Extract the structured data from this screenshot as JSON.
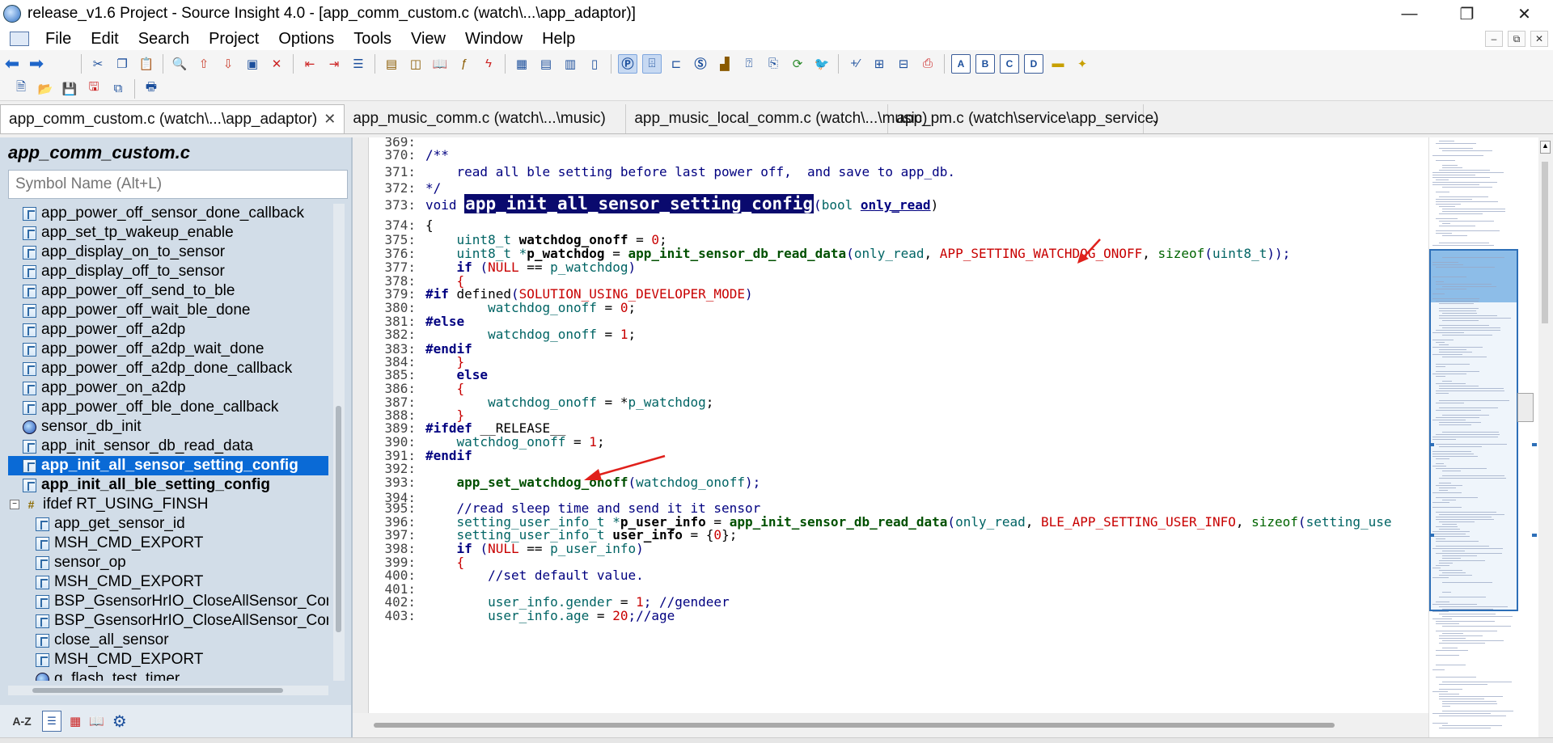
{
  "window": {
    "title": "release_v1.6 Project - Source Insight 4.0 - [app_comm_custom.c (watch\\...\\app_adaptor)]",
    "minimize_glyph": "—",
    "maximize_glyph": "❐",
    "close_glyph": "✕"
  },
  "menu": {
    "items": [
      "File",
      "Edit",
      "Search",
      "Project",
      "Options",
      "Tools",
      "View",
      "Window",
      "Help"
    ],
    "mdi_minimize": "–",
    "mdi_restore": "⧉",
    "mdi_close": "✕"
  },
  "toolbar1": {
    "buttons": [
      "back-icon",
      "forward-icon",
      "cut-icon",
      "copy-icon",
      "paste-icon",
      "find-icon",
      "jump-up-icon",
      "jump-down-icon",
      "browse-icon",
      "replace-icon",
      "bookmark-prev-icon",
      "bookmark-next-icon",
      "bookmark-list-icon",
      "project-icon",
      "symbol-window-icon",
      "book-icon",
      "function-icon",
      "lightning-icon",
      "layout-1-icon",
      "layout-2-icon",
      "layout-3-icon",
      "layout-4-icon",
      "p-icon",
      "relation-window-icon",
      "call-tree-icon",
      "s-icon",
      "blocks-icon",
      "help-icon",
      "clip-icon",
      "sync-icon",
      "bird-icon",
      "expand-icon",
      "insert-icon",
      "collapse-icon",
      "page-icon",
      "A-icon",
      "B-icon",
      "C-icon",
      "D-icon",
      "folder-icon",
      "folder-star-icon"
    ]
  },
  "toolbar2": {
    "buttons": [
      "new-file-icon",
      "open-file-icon",
      "save-icon",
      "save-all-icon",
      "close-all-icon",
      "print-icon"
    ]
  },
  "tabs": [
    {
      "label": "app_comm_custom.c (watch\\...\\app_adaptor)",
      "close": "✕"
    },
    {
      "label": "app_music_comm.c (watch\\...\\music)"
    },
    {
      "label": "app_music_local_comm.c (watch\\...\\music)"
    },
    {
      "label": "app_pm.c (watch\\service\\app_service)"
    }
  ],
  "tab_more": "⌄",
  "symbol_panel": {
    "file_title": "app_comm_custom.c",
    "search_placeholder": "Symbol Name (Alt+L)",
    "items": [
      {
        "label": "app_power_off_sensor_done_callback",
        "icon": "function-icon"
      },
      {
        "label": "app_set_tp_wakeup_enable",
        "icon": "function-icon"
      },
      {
        "label": "app_display_on_to_sensor",
        "icon": "function-icon"
      },
      {
        "label": "app_display_off_to_sensor",
        "icon": "function-icon"
      },
      {
        "label": "app_power_off_send_to_ble",
        "icon": "function-icon"
      },
      {
        "label": "app_power_off_wait_ble_done",
        "icon": "function-icon"
      },
      {
        "label": "app_power_off_a2dp",
        "icon": "function-icon"
      },
      {
        "label": "app_power_off_a2dp_wait_done",
        "icon": "function-icon"
      },
      {
        "label": "app_power_off_a2dp_done_callback",
        "icon": "function-icon"
      },
      {
        "label": "app_power_on_a2dp",
        "icon": "function-icon"
      },
      {
        "label": "app_power_off_ble_done_callback",
        "icon": "function-icon"
      },
      {
        "label": "sensor_db_init",
        "icon": "globe-icon"
      },
      {
        "label": "app_init_sensor_db_read_data",
        "icon": "function-icon"
      },
      {
        "label": "app_init_all_sensor_setting_config",
        "icon": "function-icon",
        "selected": true
      },
      {
        "label": "app_init_all_ble_setting_config",
        "icon": "function-icon",
        "bold": true
      },
      {
        "label": "ifdef RT_USING_FINSH",
        "icon": "define-icon",
        "expander": "−"
      },
      {
        "label": "app_get_sensor_id",
        "icon": "function-icon",
        "indent": true
      },
      {
        "label": "MSH_CMD_EXPORT",
        "icon": "macro-icon",
        "indent": true
      },
      {
        "label": "sensor_op",
        "icon": "function-icon",
        "indent": true
      },
      {
        "label": "MSH_CMD_EXPORT",
        "icon": "macro-icon",
        "indent": true
      },
      {
        "label": "BSP_GsensorHrIO_CloseAllSensor_Con",
        "icon": "macro-icon",
        "indent": true
      },
      {
        "label": "BSP_GsensorHrIO_CloseAllSensor_Con",
        "icon": "macro-icon",
        "indent": true
      },
      {
        "label": "close_all_sensor",
        "icon": "function-icon",
        "indent": true
      },
      {
        "label": "MSH_CMD_EXPORT",
        "icon": "macro-icon",
        "indent": true
      },
      {
        "label": "g_flash_test_timer",
        "icon": "globe-icon",
        "indent": true
      }
    ],
    "bottom_buttons": {
      "az": "A-Z",
      "list": "list-icon",
      "tree": "tree-icon",
      "book": "book-icon",
      "settings": "gear-icon"
    }
  },
  "editor": {
    "lines": [
      {
        "n": "369:"
      },
      {
        "n": "370:"
      },
      {
        "n": "371:"
      },
      {
        "n": "372:"
      },
      {
        "n": "373:"
      },
      {
        "n": "374:"
      },
      {
        "n": "375:"
      },
      {
        "n": "376:"
      },
      {
        "n": "377:"
      },
      {
        "n": "378:"
      },
      {
        "n": "379:"
      },
      {
        "n": "380:"
      },
      {
        "n": "381:"
      },
      {
        "n": "382:"
      },
      {
        "n": "383:"
      },
      {
        "n": "384:"
      },
      {
        "n": "385:"
      },
      {
        "n": "386:"
      },
      {
        "n": "387:"
      },
      {
        "n": "388:"
      },
      {
        "n": "389:"
      },
      {
        "n": "390:"
      },
      {
        "n": "391:"
      },
      {
        "n": "392:"
      },
      {
        "n": "393:"
      },
      {
        "n": "394:"
      },
      {
        "n": "395:"
      },
      {
        "n": "396:"
      },
      {
        "n": "397:"
      },
      {
        "n": "398:"
      },
      {
        "n": "399:"
      },
      {
        "n": "400:"
      },
      {
        "n": "401:"
      },
      {
        "n": "402:"
      },
      {
        "n": "403:"
      }
    ],
    "code": {
      "l370": "/**",
      "l371": "    read all ble setting before last power off,  and save to app_db.",
      "l372": "*/",
      "l373_kw": "void ",
      "l373_fn": "app_init_all_sensor_setting_config",
      "l373_paren": "(",
      "l373_type": "bool ",
      "l373_param": "only_read",
      "l373_close": ")",
      "l374": "{",
      "l375_type": "    uint8_t ",
      "l375_var": "watchdog_onoff",
      "l375_eq": " = ",
      "l375_num": "0",
      "l375_end": ";",
      "l376_type": "    uint8_t *",
      "l376_var": "p_watchdog",
      "l376_eq": " = ",
      "l376_fn": "app_init_sensor_db_read_data",
      "l376_p1": "(",
      "l376_a1": "only_read",
      "l376_c1": ", ",
      "l376_mac": "APP_SETTING_WATCHDOG_ONOFF",
      "l376_c2": ", ",
      "l376_sz": "sizeof",
      "l376_p2": "(",
      "l376_t": "uint8_t",
      "l376_end": "));",
      "l377_kw": "    if ",
      "l377_p": "(",
      "l377_mac": "NULL",
      "l377_op": " == ",
      "l377_var": "p_watchdog",
      "l377_end": ")",
      "l378": "    {",
      "l379_pp": "#if ",
      "l379_kw": "defined",
      "l379_p": "(",
      "l379_mac": "SOLUTION_USING_DEVELOPER_MODE",
      "l379_end": ")",
      "l380_var": "        watchdog_onoff",
      "l380_eq": " = ",
      "l380_num": "0",
      "l380_end": ";",
      "l381": "#else",
      "l382_var": "        watchdog_onoff",
      "l382_eq": " = ",
      "l382_num": "1",
      "l382_end": ";",
      "l383": "#endif",
      "l384": "    }",
      "l385": "    else",
      "l386": "    {",
      "l387_var": "        watchdog_onoff",
      "l387_eq": " = *",
      "l387_var2": "p_watchdog",
      "l387_end": ";",
      "l388": "    }",
      "l389_pp": "#ifdef ",
      "l389_mac": "__RELEASE__",
      "l390_var": "    watchdog_onoff",
      "l390_eq": " = ",
      "l390_num": "1",
      "l390_end": ";",
      "l391": "#endif",
      "l393_fn": "    app_set_watchdog_onoff",
      "l393_p": "(",
      "l393_var": "watchdog_onoff",
      "l393_end": ");",
      "l395": "    //read sleep time and send it it sensor",
      "l396_type": "    setting_user_info_t *",
      "l396_var": "p_user_info",
      "l396_eq": " = ",
      "l396_fn": "app_init_sensor_db_read_data",
      "l396_p": "(",
      "l396_a1": "only_read",
      "l396_c": ", ",
      "l396_mac": "BLE_APP_SETTING_USER_INFO",
      "l396_c2": ", ",
      "l396_sz": "sizeof",
      "l396_p2": "(",
      "l396_t": "setting_use",
      "l397_type": "    setting_user_info_t ",
      "l397_var": "user_info",
      "l397_eq": " = {",
      "l397_num": "0",
      "l397_end": "};",
      "l398_kw": "    if ",
      "l398_p": "(",
      "l398_mac": "NULL",
      "l398_op": " == ",
      "l398_var": "p_user_info",
      "l398_end": ")",
      "l399": "    {",
      "l400": "        //set default value.",
      "l402_var": "        user_info.gender",
      "l402_eq": " = ",
      "l402_num": "1",
      "l402_end": "; //gendeer",
      "l403_var": "        user_info.age",
      "l403_eq": " = ",
      "l403_num": "20",
      "l403_end": ";//age"
    }
  },
  "colors": {
    "selection": "#0a6ad6",
    "definition_highlight": "#0a0a6e",
    "macro_red": "#c80000",
    "type_teal": "#006464",
    "function_green": "#005000",
    "keyword_navy": "#000080",
    "annotation_arrow": "#e0201b"
  }
}
